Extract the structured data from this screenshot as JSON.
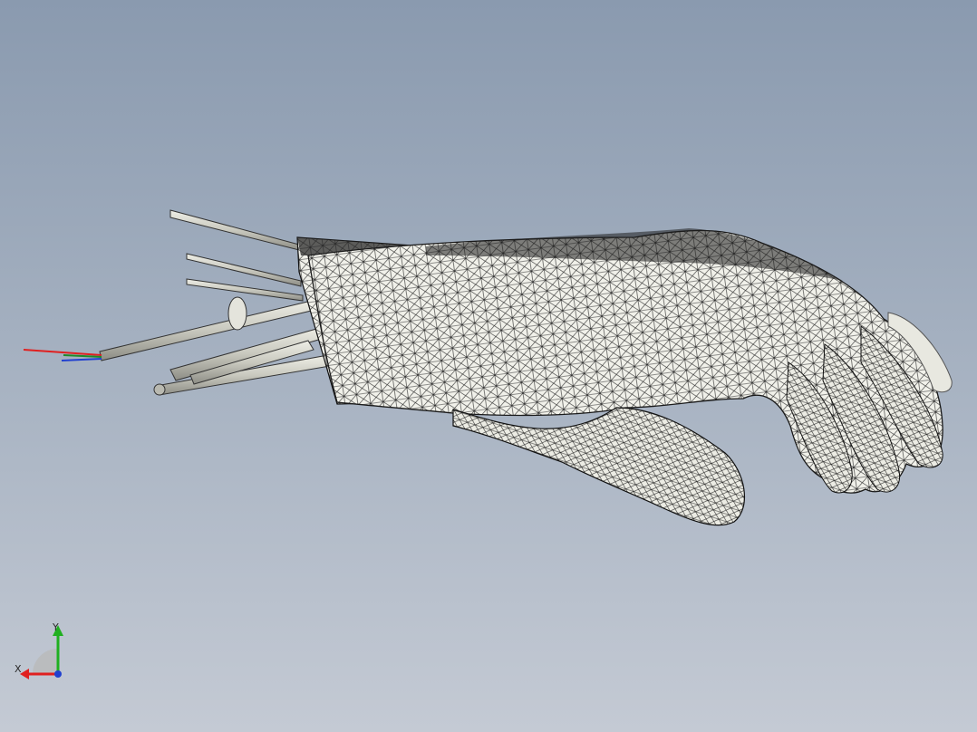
{
  "viewport": {
    "background_top": "#8a9aaf",
    "background_bottom": "#c4cad4",
    "model": {
      "description_icon": "hand-mesh-model",
      "render_mode": "shaded-with-edges",
      "mesh_color": "#f2f2ec",
      "edge_color": "#1a1a1a",
      "cable_colors": [
        "#d8d8cf",
        "#c7c7bd"
      ],
      "wire_colors": [
        "#e02020",
        "#1e8a2a",
        "#2040d0"
      ]
    }
  },
  "triad": {
    "x_label": "X",
    "y_label": "Y",
    "x_color": "#e02020",
    "y_color": "#20b020",
    "z_color": "#2040d0"
  }
}
